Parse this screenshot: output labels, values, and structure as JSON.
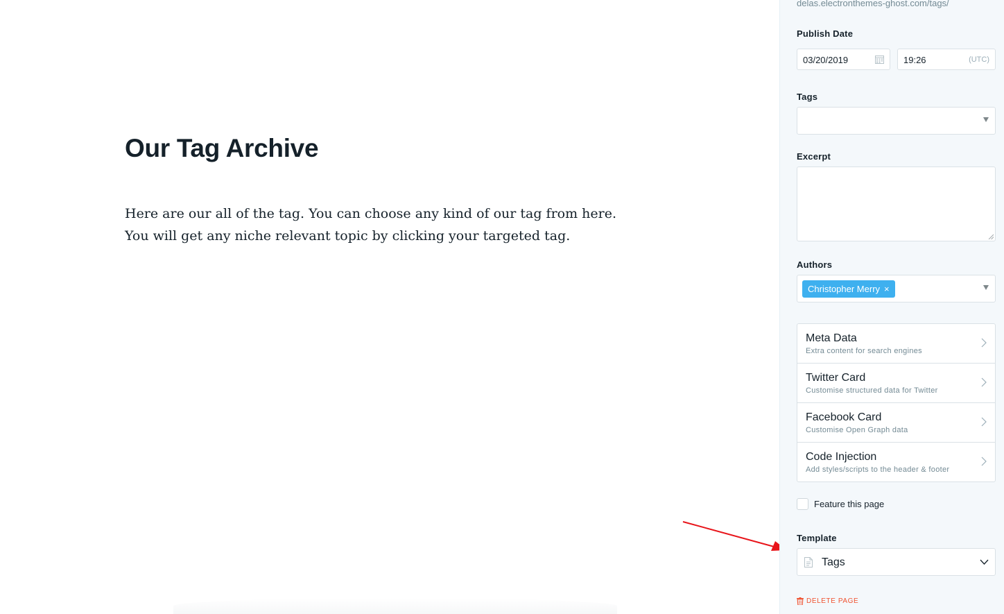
{
  "editor": {
    "title": "Our Tag Archive",
    "body": "Here are our all of the tag. You can choose any kind of our tag from here. You will get any niche relevant topic by clicking your targeted tag."
  },
  "settings": {
    "url": "delas.electronthemes-ghost.com/tags/",
    "publish_date": {
      "label": "Publish Date",
      "date": "03/20/2019",
      "time": "19:26",
      "timezone": "(UTC)"
    },
    "tags": {
      "label": "Tags",
      "value": ""
    },
    "excerpt": {
      "label": "Excerpt",
      "value": ""
    },
    "authors": {
      "label": "Authors",
      "selected": [
        "Christopher Merry"
      ],
      "remove_glyph": "×"
    },
    "nav_items": [
      {
        "title": "Meta Data",
        "description": "Extra content for search engines"
      },
      {
        "title": "Twitter Card",
        "description": "Customise structured data for Twitter"
      },
      {
        "title": "Facebook Card",
        "description": "Customise Open Graph data"
      },
      {
        "title": "Code Injection",
        "description": "Add styles/scripts to the header & footer"
      }
    ],
    "feature": {
      "label": "Feature this page",
      "checked": false
    },
    "template": {
      "label": "Template",
      "value": "Tags"
    },
    "delete": {
      "label": "DELETE PAGE"
    }
  },
  "colors": {
    "accent_blue": "#3eb0ef",
    "danger_red": "#f05230",
    "annotation_red": "#e8141a",
    "panel_bg": "#f4f8fb"
  },
  "icons": {
    "calendar": "calendar-icon",
    "dropdown": "caret-down-icon",
    "chevron": "chevron-right-icon",
    "template_file": "file-icon",
    "select": "chevron-down-icon",
    "delete": "trash-icon"
  }
}
